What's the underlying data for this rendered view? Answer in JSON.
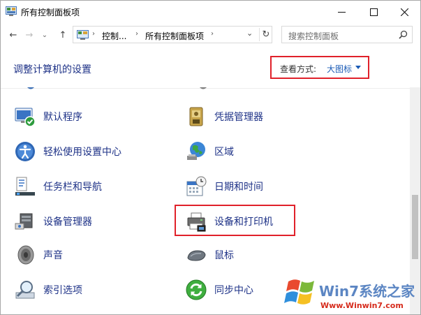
{
  "window": {
    "title": "所有控制面板项",
    "controls": {
      "minimize": "—",
      "maximize": "☐",
      "close": "✕"
    }
  },
  "navigation": {
    "back": "←",
    "forward": "→",
    "history": "⌄",
    "up": "↑",
    "breadcrumb": [
      "控制...",
      "所有控制面板项"
    ],
    "separator": "›",
    "dropdown": "⌄",
    "refresh": "↻"
  },
  "search": {
    "placeholder": "搜索控制面板"
  },
  "header": {
    "title": "调整计算机的设置",
    "view_label": "查看方式:",
    "view_value": "大图标"
  },
  "items": {
    "left": [
      {
        "label": "默认程序",
        "icon": "default-programs-icon"
      },
      {
        "label": "轻松使用设置中心",
        "icon": "ease-of-access-icon"
      },
      {
        "label": "任务栏和导航",
        "icon": "taskbar-icon"
      },
      {
        "label": "设备管理器",
        "icon": "device-manager-icon"
      },
      {
        "label": "声音",
        "icon": "sound-icon"
      },
      {
        "label": "索引选项",
        "icon": "indexing-options-icon"
      }
    ],
    "right": [
      {
        "label": "凭据管理器",
        "icon": "credential-manager-icon"
      },
      {
        "label": "区域",
        "icon": "region-icon"
      },
      {
        "label": "日期和时间",
        "icon": "date-time-icon"
      },
      {
        "label": "设备和打印机",
        "icon": "devices-printers-icon"
      },
      {
        "label": "鼠标",
        "icon": "mouse-icon"
      },
      {
        "label": "同步中心",
        "icon": "sync-center-icon"
      }
    ]
  },
  "watermark": {
    "brand": "Win7系统之家",
    "url": "Www.Winwin7.com"
  },
  "colors": {
    "link": "#1e3287",
    "accent": "#1a5bb6",
    "highlight_border": "#e0212a"
  }
}
